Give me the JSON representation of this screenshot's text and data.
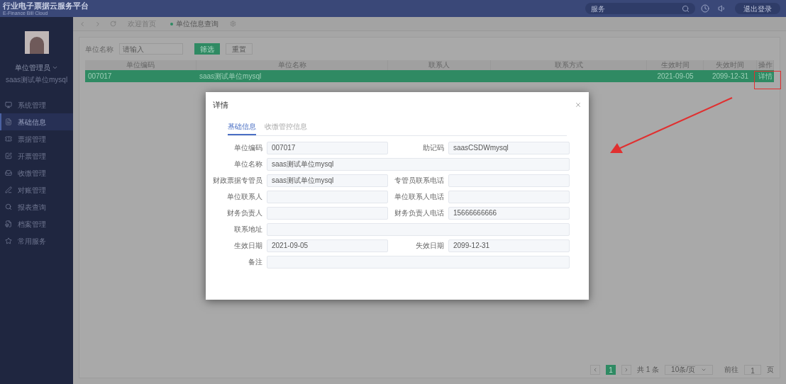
{
  "header": {
    "title": "行业电子票据云服务平台",
    "subtitle": "E-Finance Bill Cloud",
    "search_value": "服务",
    "logout": "退出登录"
  },
  "user": {
    "name": "单位管理员",
    "org": "saas测试单位mysql"
  },
  "sidebar": {
    "items": [
      {
        "label": "系统管理",
        "selected": false
      },
      {
        "label": "基础信息",
        "selected": true
      },
      {
        "label": "票据管理",
        "selected": false
      },
      {
        "label": "开票管理",
        "selected": false
      },
      {
        "label": "收缴管理",
        "selected": false
      },
      {
        "label": "对账管理",
        "selected": false
      },
      {
        "label": "报表查询",
        "selected": false
      },
      {
        "label": "档案管理",
        "selected": false
      },
      {
        "label": "常用服务",
        "selected": false
      }
    ]
  },
  "tabs": [
    {
      "label": "欢迎首页",
      "selected": false
    },
    {
      "label": "单位信息查询",
      "selected": true
    }
  ],
  "filter": {
    "label": "单位名称",
    "placeholder": "请输入",
    "buttons": [
      {
        "label": "筛选",
        "kind": "primary"
      },
      {
        "label": "重置",
        "kind": "plain"
      }
    ]
  },
  "table": {
    "columns": [
      "单位编码",
      "单位名称",
      "联系人",
      "联系方式",
      "生效时间",
      "失效时间",
      "操作"
    ],
    "rows": [
      {
        "selected": true,
        "cells": [
          "007017",
          "saas测试单位mysql",
          "",
          "",
          "2021-09-05",
          "2099-12-31"
        ],
        "action": "详情"
      }
    ]
  },
  "pagination": {
    "pages": [
      {
        "label": "1",
        "selected": true
      }
    ],
    "total": "共 1 条",
    "page_size": "10条/页",
    "goto_label": "前往",
    "goto_value": "1",
    "page_suffix": "页"
  },
  "dialog": {
    "title": "详情",
    "tabs": [
      {
        "label": "基础信息",
        "selected": true
      },
      {
        "label": "收缴管控信息",
        "selected": false
      }
    ],
    "fields": [
      {
        "label": "单位编码",
        "value": "007017",
        "kind": "half"
      },
      {
        "label": "助记码",
        "value": "saasCSDWmysql",
        "kind": "half"
      },
      {
        "label": "单位名称",
        "value": "saas测试单位mysql",
        "kind": "full"
      },
      {
        "label": "财政票据专管员",
        "value": "saas测试单位mysql",
        "kind": "half"
      },
      {
        "label": "专管员联系电话",
        "kind": "half"
      },
      {
        "label": "单位联系人",
        "kind": "half"
      },
      {
        "label": "单位联系人电话",
        "kind": "half"
      },
      {
        "label": "财务负责人",
        "kind": "half"
      },
      {
        "label": "财务负责人电话",
        "value": "15666666666",
        "kind": "half"
      },
      {
        "label": "联系地址",
        "kind": "full"
      },
      {
        "label": "生效日期",
        "value": "2021-09-05",
        "kind": "half"
      },
      {
        "label": "失效日期",
        "value": "2099-12-31",
        "kind": "half"
      },
      {
        "label": "备注",
        "kind": "full"
      }
    ]
  }
}
